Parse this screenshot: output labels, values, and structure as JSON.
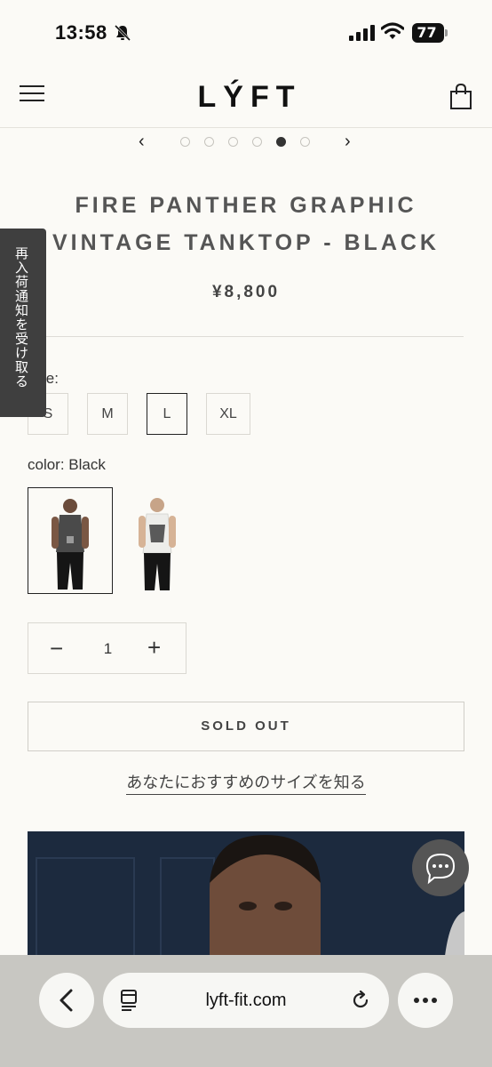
{
  "status_bar": {
    "time": "13:58",
    "battery": "77"
  },
  "header": {
    "logo": "LÝFT"
  },
  "carousel": {
    "prev": "‹",
    "next": "›",
    "active_index": 4
  },
  "product": {
    "title_line1": "FIRE PANTHER GRAPHIC",
    "title_line2": "VINTAGE TANKTOP - BLACK",
    "price": "¥8,800"
  },
  "notify_tab": {
    "label": "再入荷通知を受け取る"
  },
  "size": {
    "label": "size:",
    "options": [
      "S",
      "M",
      "L",
      "XL"
    ],
    "selected": "L"
  },
  "color": {
    "label": "color: Black"
  },
  "quantity": {
    "minus": "−",
    "value": "1",
    "plus": "+"
  },
  "buttons": {
    "sold_out": "SOLD OUT",
    "size_link": "あなたにおすすめのサイズを知る"
  },
  "browser": {
    "url": "lyft-fit.com"
  },
  "colors": {
    "background": "#FBFAF6",
    "text": "#222222",
    "hero": "#1C2A3E"
  }
}
